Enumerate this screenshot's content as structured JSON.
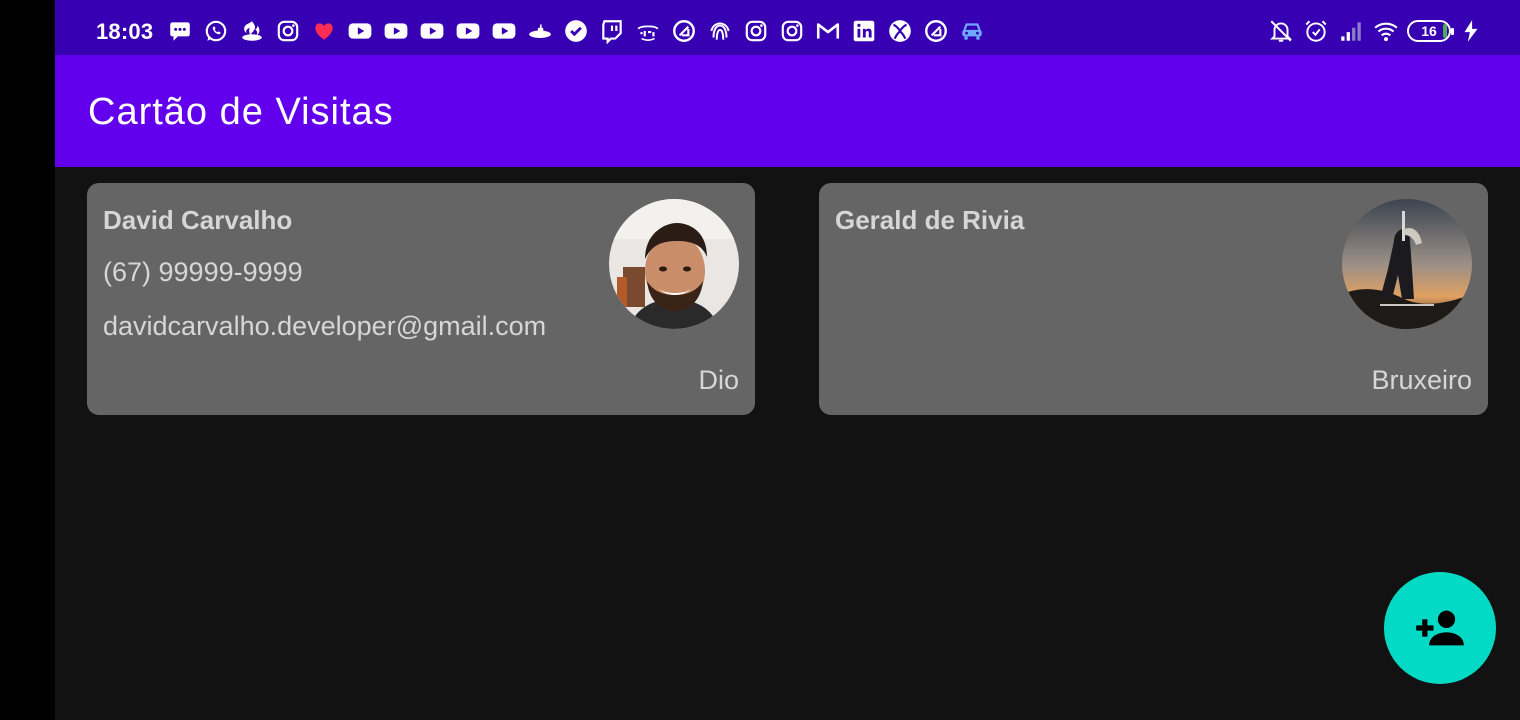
{
  "status_bar": {
    "time": "18:03",
    "battery_level": "16",
    "notification_icons": [
      "message-icon",
      "whatsapp-icon",
      "santander-icon",
      "instagram-icon",
      "heart-icon",
      "youtube-icon",
      "youtube-icon",
      "youtube-icon",
      "youtube-icon",
      "youtube-icon",
      "submarine-icon",
      "check-badge-icon",
      "twitch-icon",
      "ifood-icon",
      "nucleus-icon",
      "fingerprint-icon",
      "instagram-icon",
      "instagram-icon",
      "gmail-icon",
      "linkedin-icon",
      "xbox-icon",
      "nucleus-icon",
      "car-icon"
    ],
    "system_icons": [
      "silent-icon",
      "alarm-icon",
      "signal-icon",
      "wifi-icon",
      "battery-icon",
      "charging-icon"
    ]
  },
  "app_bar": {
    "title": "Cartão de Visitas"
  },
  "cards": [
    {
      "name": "David Carvalho",
      "phone": "(67) 99999-9999",
      "email": "davidcarvalho.developer@gmail.com",
      "company": "Dio",
      "avatar": "profile-photo"
    },
    {
      "name": "Gerald de Rivia",
      "phone": "",
      "email": "",
      "company": "Bruxeiro",
      "avatar": "witcher-poster"
    }
  ],
  "fab": {
    "icon": "person-add-icon"
  },
  "colors": {
    "status_bar": "#3700b3",
    "app_bar": "#6200ee",
    "background": "#121212",
    "card": "#656565",
    "card_text": "#d6d6d6",
    "fab": "#03dac5"
  }
}
